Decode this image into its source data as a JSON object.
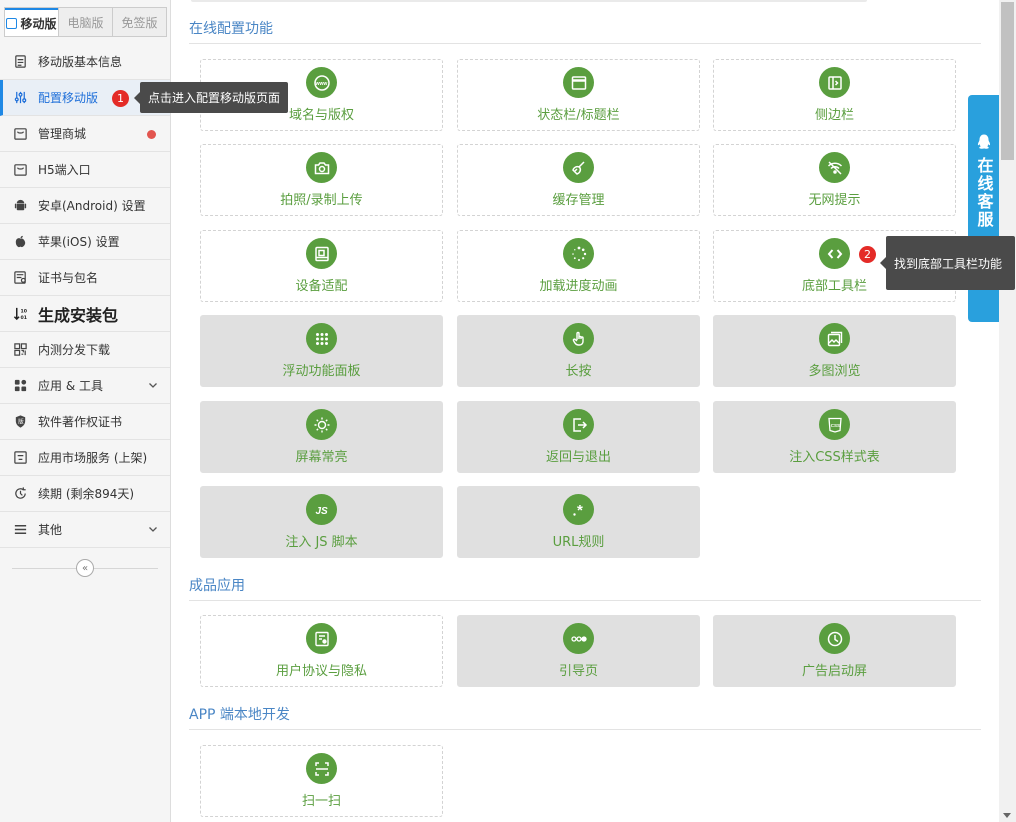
{
  "top_tabs": [
    {
      "label": "移动版",
      "active": true
    },
    {
      "label": "电脑版",
      "active": false
    },
    {
      "label": "免签版",
      "active": false
    }
  ],
  "sidebar": {
    "items": [
      {
        "label": "移动版基本信息",
        "icon": "document-icon"
      },
      {
        "label": "配置移动版",
        "icon": "sliders-icon",
        "active": true
      },
      {
        "label": "管理商城",
        "icon": "shop-icon",
        "dot": true
      },
      {
        "label": "H5端入口",
        "icon": "h5-icon"
      },
      {
        "label": "安卓(Android) 设置",
        "icon": "android-icon"
      },
      {
        "label": "苹果(iOS) 设置",
        "icon": "apple-icon"
      },
      {
        "label": "证书与包名",
        "icon": "certificate-icon"
      },
      {
        "label": "生成安装包",
        "icon": "sort-download-icon",
        "big": true
      },
      {
        "label": "内测分发下载",
        "icon": "qrcode-icon"
      },
      {
        "label": "应用 & 工具",
        "icon": "grid-icon",
        "expandable": true
      },
      {
        "label": "软件著作权证书",
        "icon": "shield-icon"
      },
      {
        "label": "应用市场服务 (上架)",
        "icon": "market-icon"
      },
      {
        "label": "续期 (剩余894天)",
        "icon": "renew-icon"
      },
      {
        "label": "其他",
        "icon": "menu-icon",
        "expandable": true
      }
    ],
    "collapse_glyph": "«"
  },
  "sections": {
    "online": {
      "title": "在线配置功能"
    },
    "products": {
      "title": "成品应用"
    },
    "local_dev": {
      "title": "APP 端本地开发"
    }
  },
  "cards": [
    {
      "label": "域名与版权",
      "icon": "www-icon",
      "enabled": true
    },
    {
      "label": "状态栏/标题栏",
      "icon": "window-icon",
      "enabled": true
    },
    {
      "label": "侧边栏",
      "icon": "sidebar-icon",
      "enabled": true
    },
    {
      "label": "拍照/录制上传",
      "icon": "camera-icon",
      "enabled": true
    },
    {
      "label": "缓存管理",
      "icon": "broom-icon",
      "enabled": true
    },
    {
      "label": "无网提示",
      "icon": "no-wifi-icon",
      "enabled": true
    },
    {
      "label": "设备适配",
      "icon": "devices-icon",
      "enabled": true
    },
    {
      "label": "加载进度动画",
      "icon": "spinner-icon",
      "enabled": true
    },
    {
      "label": "底部工具栏",
      "icon": "code-icon",
      "enabled": true
    },
    {
      "label": "浮动功能面板",
      "icon": "dots-grid-icon",
      "enabled": false
    },
    {
      "label": "长按",
      "icon": "hand-icon",
      "enabled": false
    },
    {
      "label": "多图浏览",
      "icon": "gallery-icon",
      "enabled": false
    },
    {
      "label": "屏幕常亮",
      "icon": "sun-icon",
      "enabled": false
    },
    {
      "label": "返回与退出",
      "icon": "exit-icon",
      "enabled": false
    },
    {
      "label": "注入CSS样式表",
      "icon": "css-icon",
      "enabled": false
    },
    {
      "label": "注入 JS 脚本",
      "icon": "js-icon",
      "enabled": false
    },
    {
      "label": "URL规则",
      "icon": "asterisk-icon",
      "enabled": false
    }
  ],
  "product_cards": [
    {
      "label": "用户协议与隐私",
      "icon": "agreement-icon",
      "enabled": true
    },
    {
      "label": "引导页",
      "icon": "pager-icon",
      "enabled": false
    },
    {
      "label": "广告启动屏",
      "icon": "clock-icon",
      "enabled": false
    }
  ],
  "local_cards": [
    {
      "label": "扫一扫",
      "icon": "scan-icon",
      "enabled": true
    }
  ],
  "service": {
    "label": "在线客服",
    "icon": "qq-icon"
  },
  "tooltips": [
    {
      "number": "1",
      "text": "点击进入配置移动版页面"
    },
    {
      "number": "2",
      "text": "找到底部工具栏功能"
    }
  ],
  "colors": {
    "accent_green": "#5a9e3f",
    "accent_blue": "#1e88e5",
    "service_blue": "#29a0dd",
    "badge_red": "#e42b27",
    "section_title": "#4a86c5"
  }
}
